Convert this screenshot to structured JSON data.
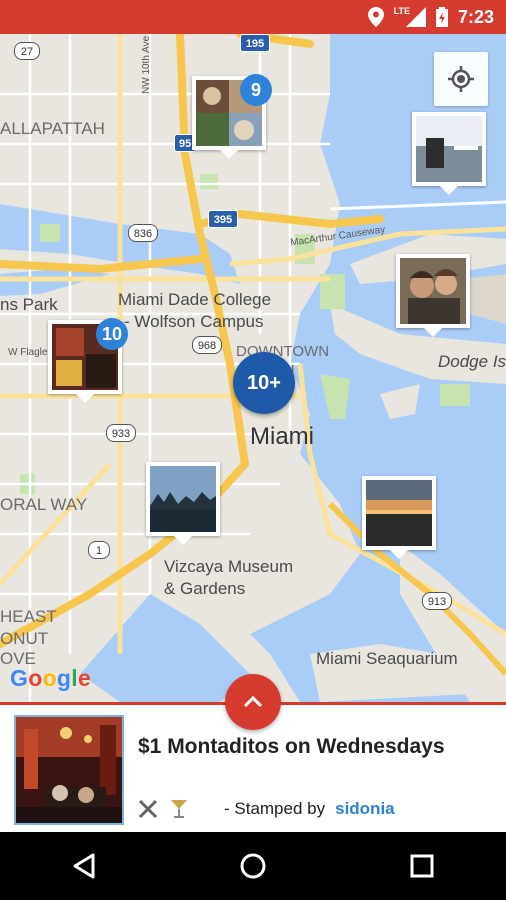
{
  "status_bar": {
    "time": "7:23",
    "network": "LTE",
    "icons": [
      "location-icon",
      "signal-icon",
      "battery-icon"
    ],
    "color": "#d63b2f"
  },
  "map": {
    "labels": {
      "allapattah": "ALLAPATTAH",
      "ns_park": "ns Park",
      "college_line1": "Miami Dade College",
      "college_line2": "- Wolfson Campus",
      "downtown": "DOWNTOWN",
      "ami": "AMI",
      "miami": "Miami",
      "dodge": "Dodge Is",
      "coral_way": "ORAL WAY",
      "vizcaya_line1": "Vizcaya Museum",
      "vizcaya_line2": "& Gardens",
      "seaquarium": "Miami Seaquarium",
      "heast": "HEAST",
      "onut": "ONUT",
      "ove": "OVE",
      "nw10": "NW 10th Ave",
      "macarthur": "MacArthur Causeway",
      "w_flagler": "W Flagler"
    },
    "shields": {
      "i27": "27",
      "i195": "195",
      "i95": "95",
      "r836": "836",
      "i395": "395",
      "r968": "968",
      "r933": "933",
      "us1": "1",
      "r913": "913"
    },
    "clusters": {
      "top_count": "9",
      "left_count": "10",
      "center_count": "10+"
    },
    "google_logo": [
      "G",
      "o",
      "o",
      "g",
      "l",
      "e"
    ],
    "colors": {
      "water": "#aacdf7",
      "land": "#e9e6df",
      "highway": "#f7c64d",
      "park": "#c6e3b0",
      "badge": "#2e83d8",
      "cluster": "#1e5aa8"
    }
  },
  "card": {
    "title": "$1 Montaditos on Wednesdays",
    "stamped_prefix": "- Stamped by",
    "user": "sidonia",
    "category_icons": [
      "restaurant-icon",
      "cocktail-icon"
    ]
  },
  "nav": {
    "buttons": [
      "back-icon",
      "home-icon",
      "recents-icon"
    ]
  }
}
